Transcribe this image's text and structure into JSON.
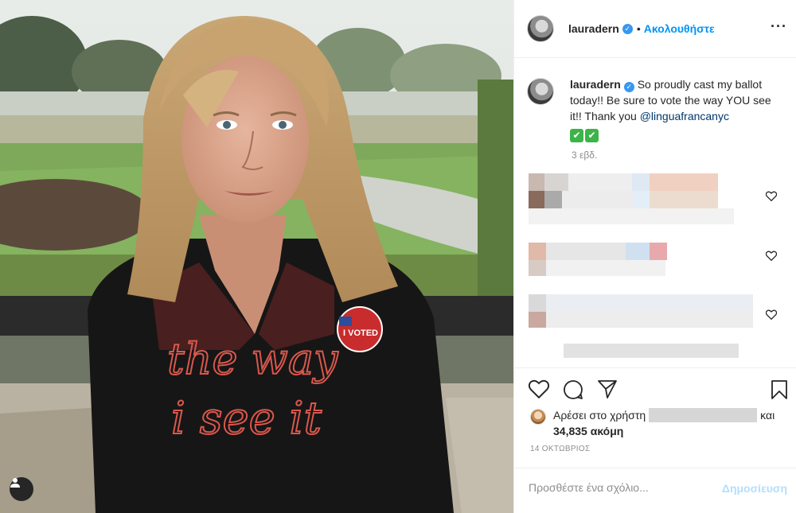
{
  "post": {
    "username": "lauradern",
    "verified_icon": "verified-badge-icon",
    "follow_label": "Ακολουθήστε",
    "more_icon": "more-options-icon",
    "photo": {
      "subject": "woman-in-black-sweater-with-i-voted-sticker",
      "sweater_text_line1": "the way",
      "sweater_text_line2": "i see it",
      "sticker_text": "I VOTED"
    },
    "caption": {
      "username": "lauradern",
      "text": "So proudly cast my ballot today!! Be sure to vote the way YOU see it!! Thank you",
      "mention": "@linguafrancanyc",
      "emoji": [
        "✔",
        "✔"
      ],
      "time_ago": "3 εβδ."
    },
    "likes": {
      "prefix": "Αρέσει στο χρήστη",
      "conjunction": "και",
      "count_text": "34,835 ακόμη"
    },
    "date": "14 ΟΚΤΩΒΡΙΟΣ",
    "comment_box": {
      "placeholder": "Προσθέστε ένα σχόλιο...",
      "post_label": "Δημοσίευση"
    }
  },
  "colors": {
    "link": "#0095f6",
    "mention": "#00376b",
    "muted": "#8e8e8e",
    "border": "#efefef",
    "post_disabled": "#b2dffc"
  }
}
